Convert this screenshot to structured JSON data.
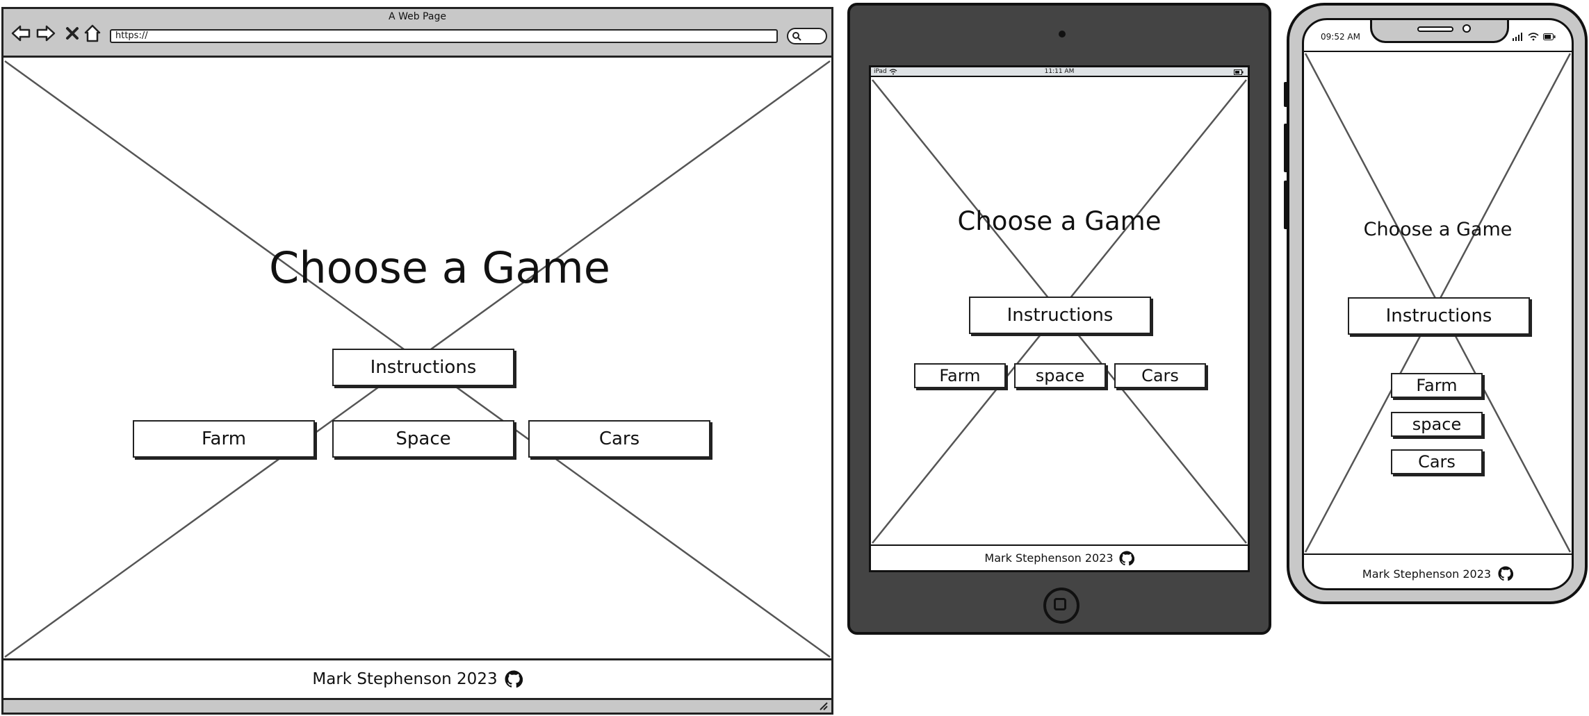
{
  "desktop": {
    "window_title": "A Web Page",
    "url": "https://",
    "heading": "Choose a Game",
    "buttons": {
      "instructions": "Instructions",
      "farm": "Farm",
      "space": "Space",
      "cars": "Cars"
    },
    "footer_text": "Mark Stephenson 2023"
  },
  "tablet": {
    "status_left": "iPad",
    "status_time": "11:11 AM",
    "heading": "Choose a Game",
    "buttons": {
      "instructions": "Instructions",
      "farm": "Farm",
      "space": "space",
      "cars": "Cars"
    },
    "footer_text": "Mark Stephenson 2023"
  },
  "phone": {
    "status_time": "09:52 AM",
    "heading": "Choose a Game",
    "buttons": {
      "instructions": "Instructions",
      "farm": "Farm",
      "space": "space",
      "cars": "Cars"
    },
    "footer_text": "Mark Stephenson 2023"
  },
  "icons": [
    "back-arrow-icon",
    "forward-arrow-icon",
    "close-icon",
    "home-icon",
    "search-icon",
    "github-icon",
    "wifi-icon",
    "battery-icon",
    "signal-icon",
    "resize-grip-icon"
  ]
}
